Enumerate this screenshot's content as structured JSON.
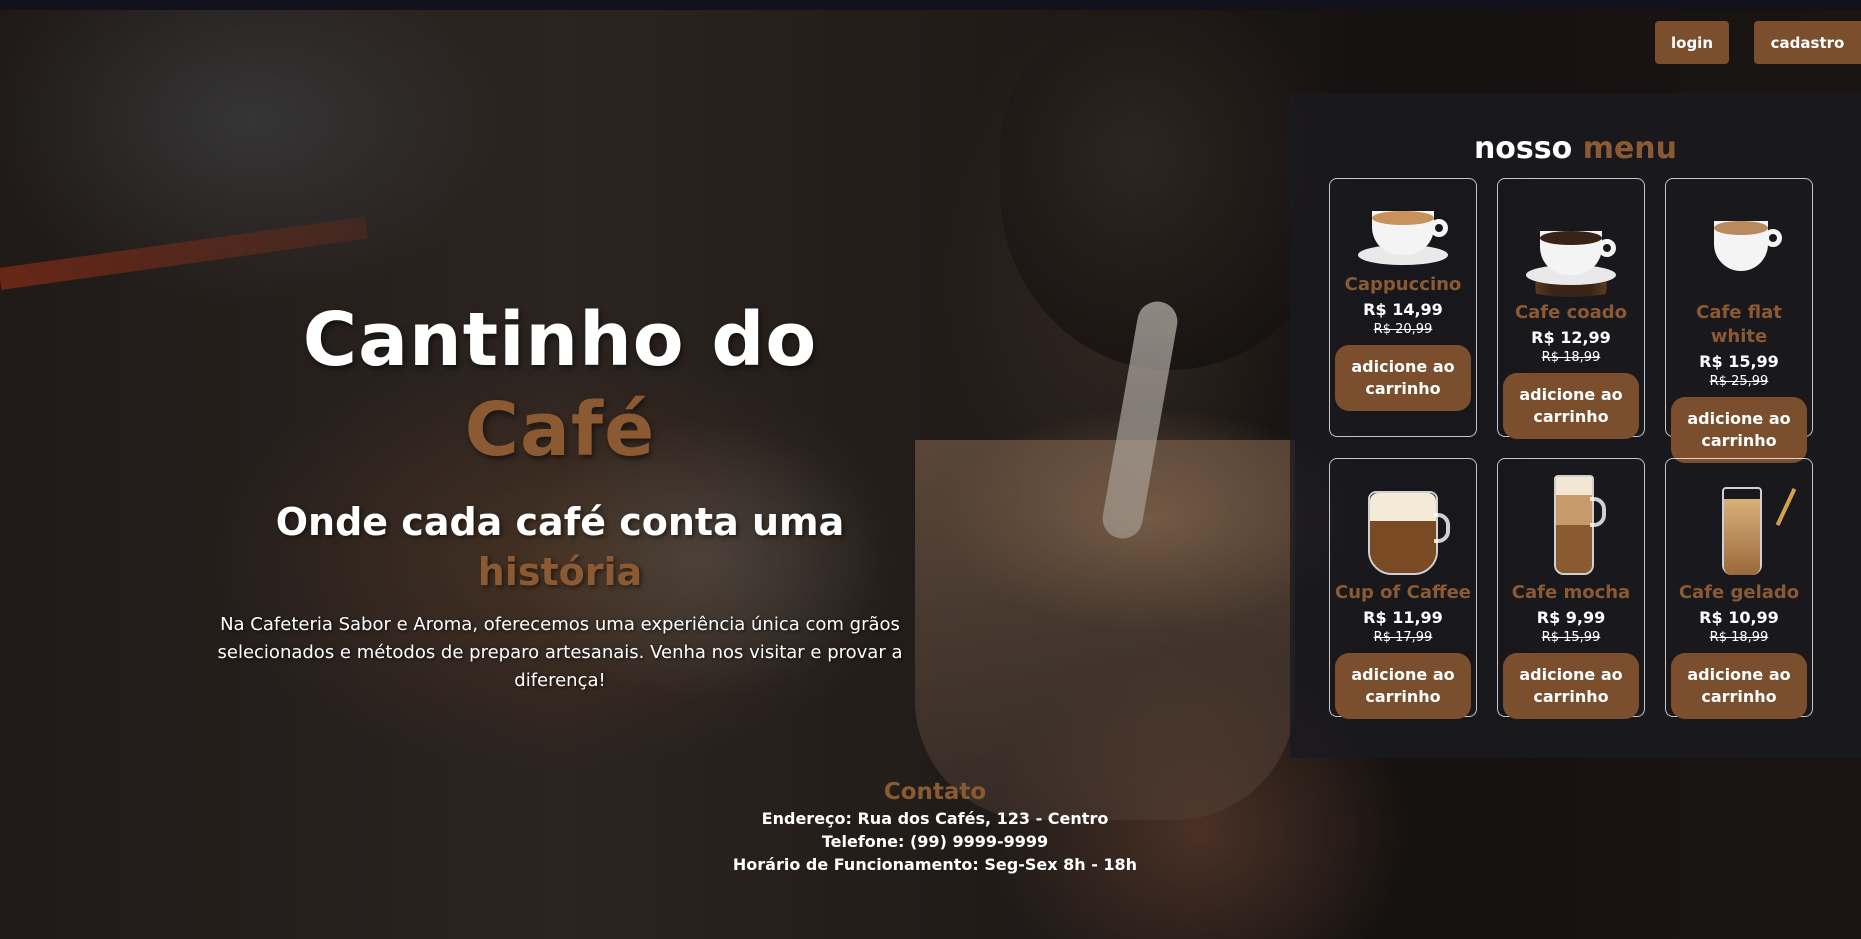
{
  "nav": {
    "login": "login",
    "cadastro": "cadastro"
  },
  "hero": {
    "title_main": "Cantinho do",
    "title_accent": "Café",
    "subtitle_main": "Onde cada café conta uma",
    "subtitle_accent": "história",
    "description": "Na Cafeteria Sabor e Aroma, oferecemos uma experiência única com grãos selecionados e métodos de preparo artesanais. Venha nos visitar e provar a diferença!"
  },
  "menu": {
    "title_main": "nosso",
    "title_accent": "menu",
    "items": [
      {
        "name": "Cappuccino",
        "price": "R$ 14,99",
        "old_price": "R$ 20,99",
        "button": "adicione ao carrinho",
        "icon": "cappuccino-icon"
      },
      {
        "name": "Cafe coado",
        "price": "R$ 12,99",
        "old_price": "R$ 18,99",
        "button": "adicione ao carrinho",
        "icon": "coffee-beans-cup-icon"
      },
      {
        "name": "Cafe flat white",
        "price": "R$ 15,99",
        "old_price": "R$ 25,99",
        "button": "adicione ao carrinho",
        "icon": "flat-white-icon"
      },
      {
        "name": "Cup of Caffee",
        "price": "R$ 11,99",
        "old_price": "R$ 17,99",
        "button": "adicione ao carrinho",
        "icon": "cream-coffee-mug-icon"
      },
      {
        "name": "Cafe mocha",
        "price": "R$ 9,99",
        "old_price": "R$ 15,99",
        "button": "adicione ao carrinho",
        "icon": "mocha-glass-icon"
      },
      {
        "name": "Cafe gelado",
        "price": "R$ 10,99",
        "old_price": "R$ 18,99",
        "button": "adicione ao carrinho",
        "icon": "iced-coffee-icon"
      }
    ]
  },
  "contact": {
    "title": "Contato",
    "address": "Endereço: Rua dos Cafés, 123 - Centro",
    "phone": "Telefone: (99) 9999-9999",
    "hours": "Horário de Funcionamento: Seg-Sex 8h - 18h"
  },
  "colors": {
    "accent": "#8b5a33",
    "button": "#7b4f2e",
    "topbar": "#13111c"
  }
}
